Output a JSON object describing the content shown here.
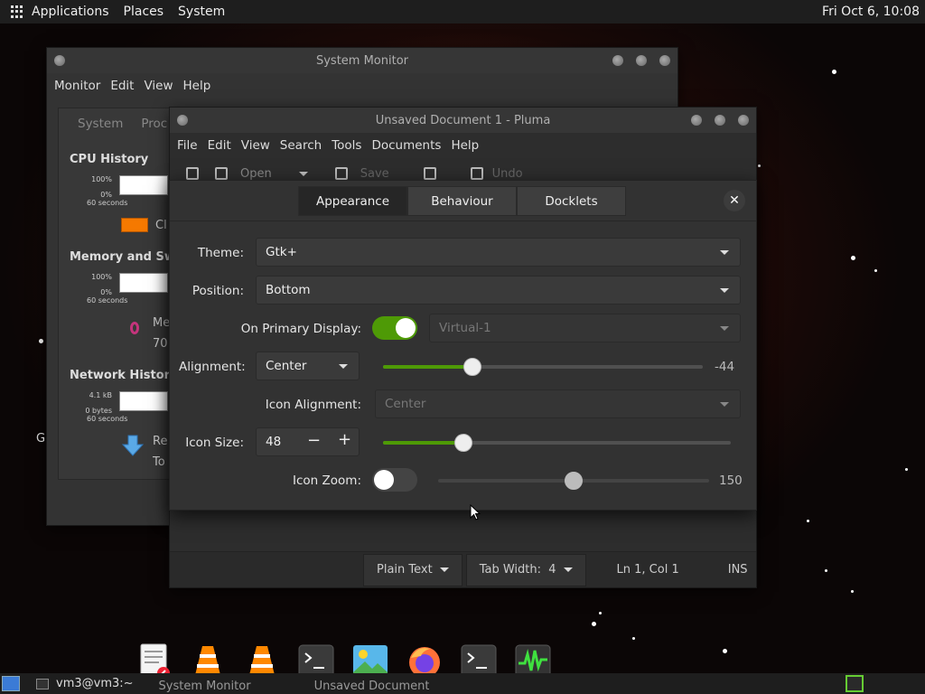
{
  "top_panel": {
    "menus": [
      "Applications",
      "Places",
      "System"
    ],
    "clock": "Fri Oct  6, 10:08"
  },
  "system_monitor": {
    "title": "System Monitor",
    "menus": [
      "Monitor",
      "Edit",
      "View",
      "Help"
    ],
    "tabs": [
      "System",
      "Proc"
    ],
    "cpu_history": "CPU History",
    "memory_history": "Memory and Swap",
    "network_history": "Network History",
    "cpu_top": "100%",
    "cpu_bottom": "0%",
    "seconds": "60 seconds",
    "mem_top": "100%",
    "mem_bottom": "0%",
    "net_top": "4.1 kB",
    "net_bottom": "0 bytes",
    "cpu_legend": "Cl",
    "mem_legend": "Me",
    "mem_value": "70",
    "net_recv": "Re",
    "net_total": "To",
    "partial_left": "G"
  },
  "pluma": {
    "title": "Unsaved Document 1 - Pluma",
    "menus": [
      "File",
      "Edit",
      "View",
      "Search",
      "Tools",
      "Documents",
      "Help"
    ],
    "toolbar": {
      "open": "Open",
      "save": "Save",
      "undo": "Undo"
    },
    "status": {
      "syntax": "Plain Text",
      "tab_width": "Tab Width:  4",
      "position": "Ln 1, Col 1",
      "mode": "INS"
    }
  },
  "dialog": {
    "tabs": [
      "Appearance",
      "Behaviour",
      "Docklets"
    ],
    "close": "✕",
    "theme_label": "Theme:",
    "theme_value": "Gtk+",
    "position_label": "Position:",
    "position_value": "Bottom",
    "primary_label": "On Primary Display:",
    "primary_on": true,
    "monitor_value": "Virtual-1",
    "alignment_label": "Alignment:",
    "alignment_value": "Center",
    "offset_value": "-44",
    "offset_level": 0.28,
    "icon_alignment_label": "Icon Alignment:",
    "icon_alignment_value": "Center",
    "icon_size_label": "Icon Size:",
    "icon_size_value": "48",
    "icon_size_level": 0.23,
    "minus": "−",
    "plus": "+",
    "icon_zoom_label": "Icon Zoom:",
    "icon_zoom_on": false,
    "zoom_value": "150",
    "zoom_level": 0.5,
    "accent": "#4e9a06"
  },
  "dock": {
    "apps": [
      "text-editor-icon",
      "vlc-icon",
      "vlc-icon",
      "terminal-icon",
      "image-viewer-icon",
      "firefox-icon",
      "terminal-icon",
      "system-monitor-icon"
    ]
  },
  "bottom_panel": {
    "task1": "vm3@vm3:~",
    "task2": "System Monitor",
    "task3": "Unsaved Document"
  }
}
